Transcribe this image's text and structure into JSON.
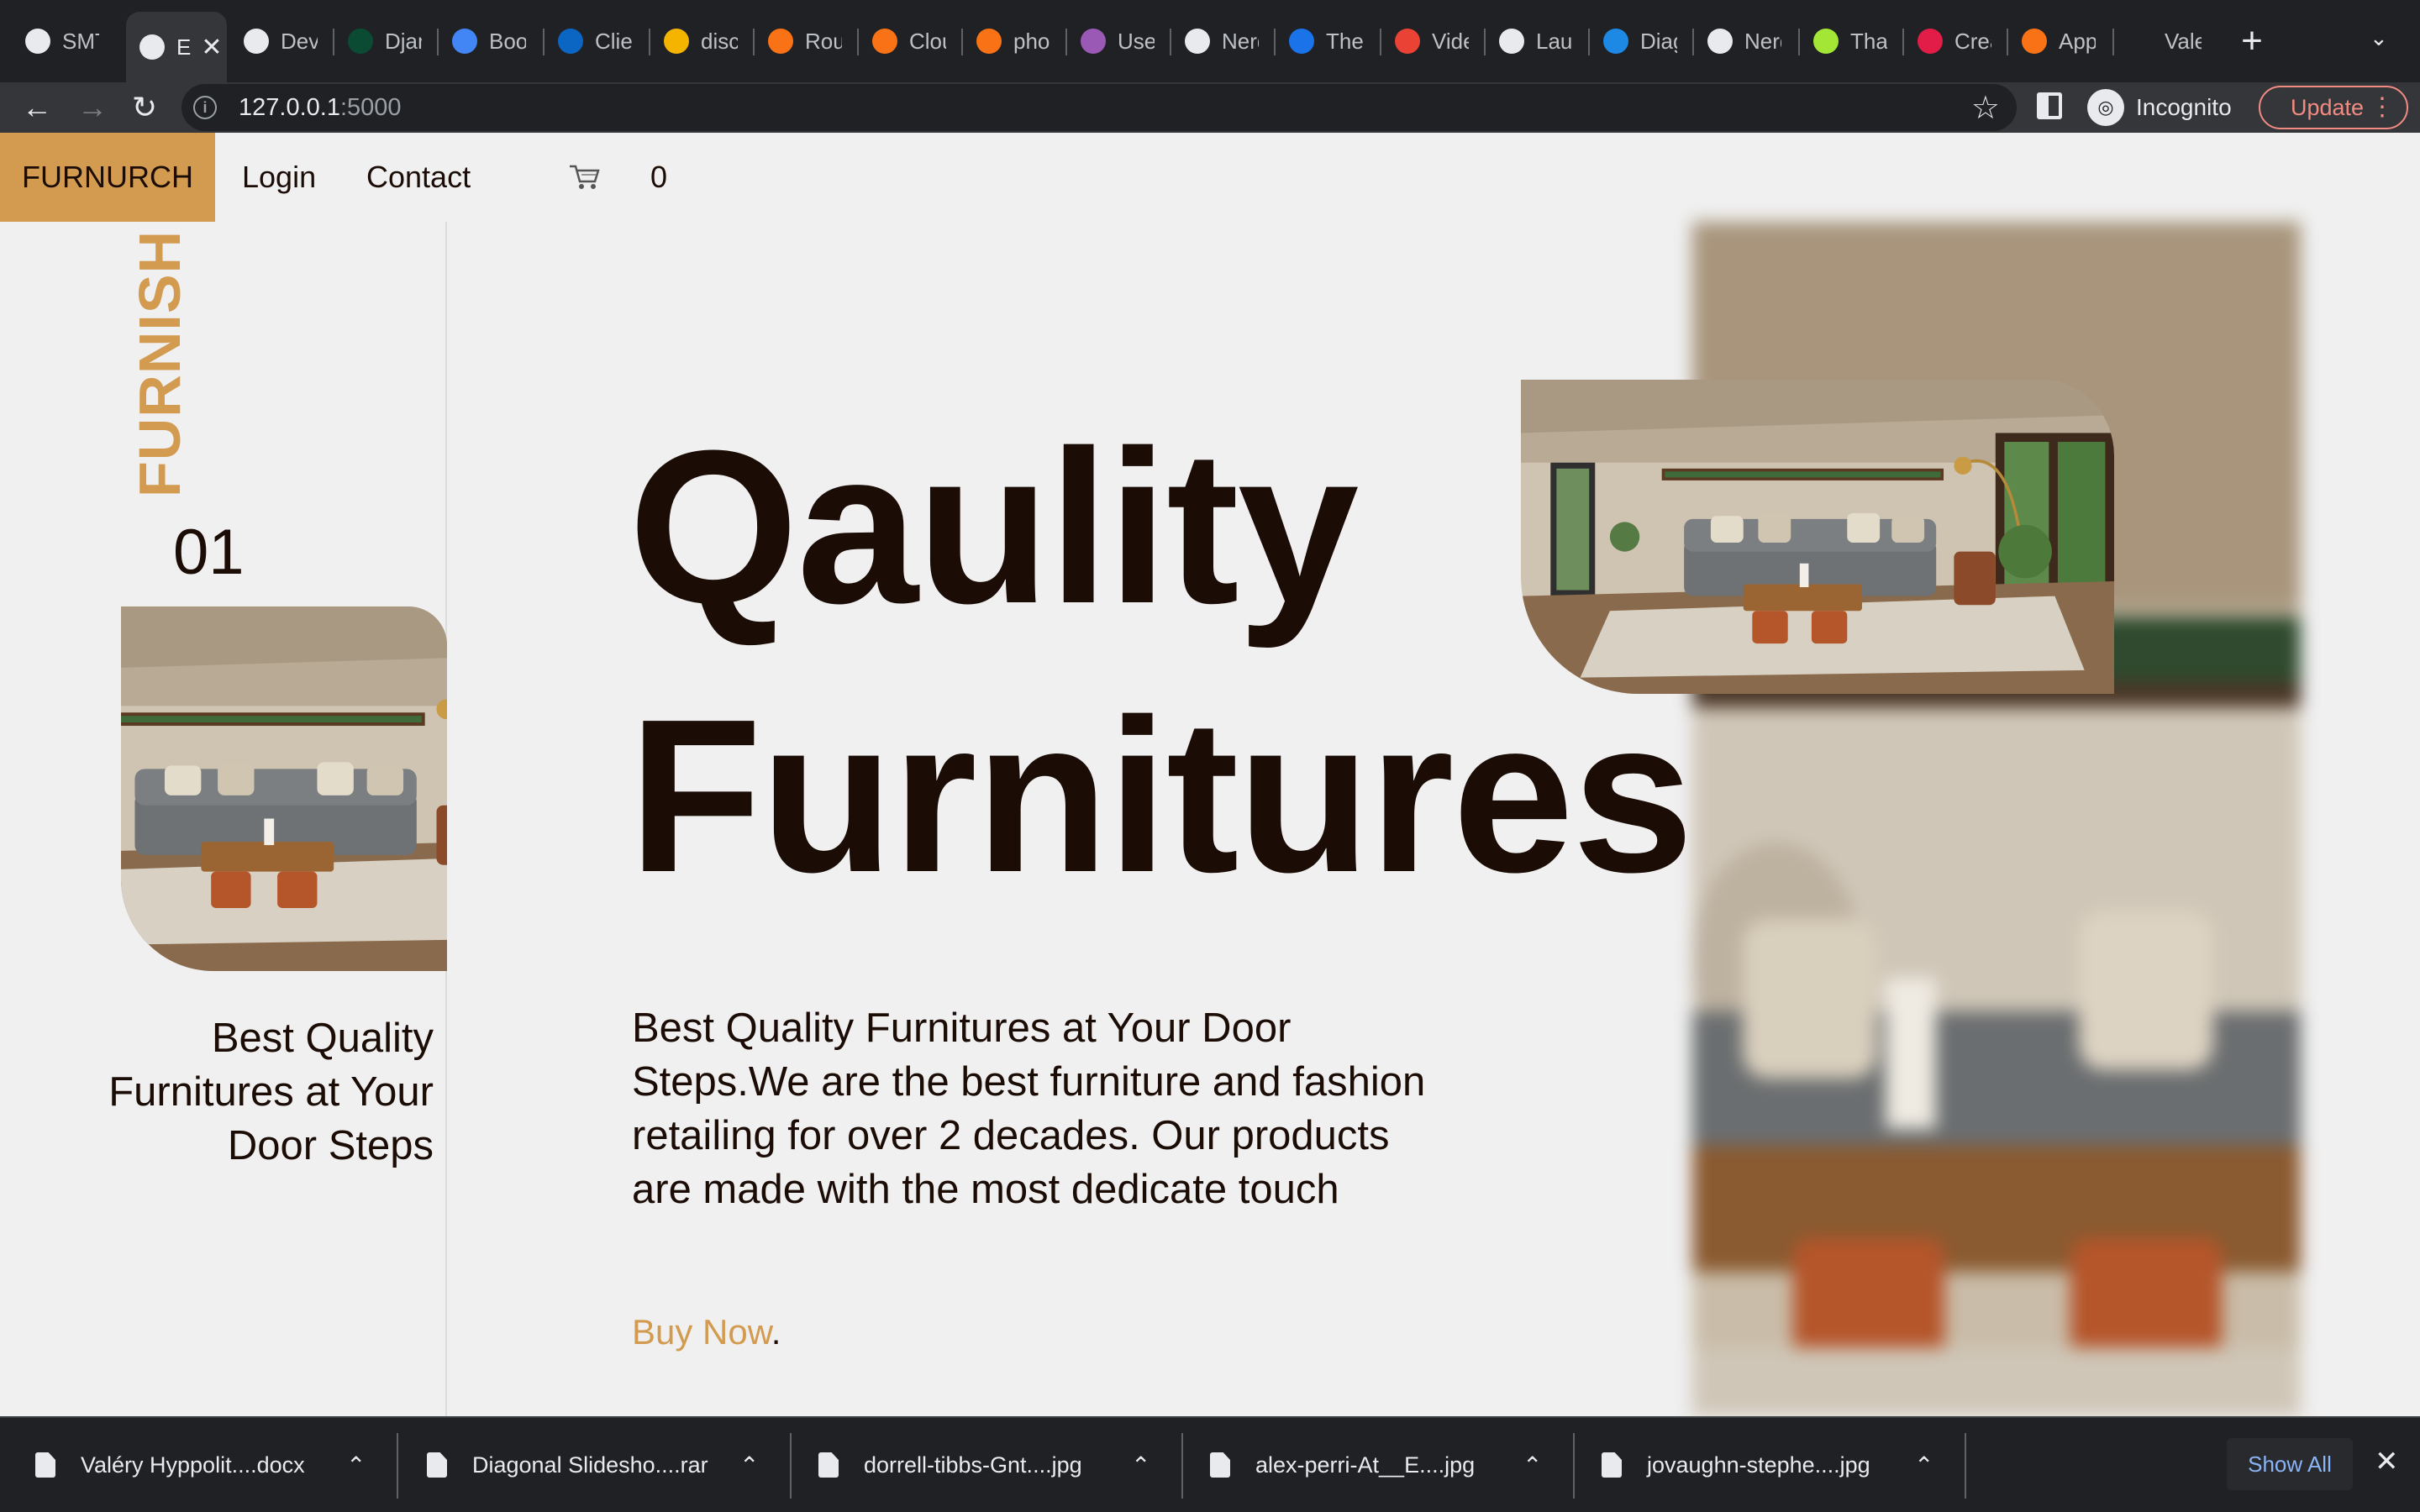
{
  "browser": {
    "tabs": [
      {
        "label": "SMT",
        "icon": "globe-icon",
        "color": "#e8eaed"
      },
      {
        "label": "E",
        "icon": "globe-icon",
        "color": "#e8eaed",
        "active": true
      },
      {
        "label": "Dev",
        "icon": "globe-icon",
        "color": "#e8eaed"
      },
      {
        "label": "Djan",
        "icon": "django-icon",
        "color": "#0c4b33"
      },
      {
        "label": "Boo",
        "icon": "bootstrap-icon",
        "color": "#4285f4"
      },
      {
        "label": "Clie",
        "icon": "linkedin-icon",
        "color": "#0a66c2"
      },
      {
        "label": "disc",
        "icon": "box-icon",
        "color": "#f4b400"
      },
      {
        "label": "Rou",
        "icon": "cube-icon",
        "color": "#f97316"
      },
      {
        "label": "Clou",
        "icon": "cube-icon",
        "color": "#f97316"
      },
      {
        "label": "pho",
        "icon": "cube-icon",
        "color": "#f97316"
      },
      {
        "label": "Use",
        "icon": "hexagon-icon",
        "color": "#9b59b6"
      },
      {
        "label": "Nerd",
        "icon": "globe-icon",
        "color": "#e8eaed"
      },
      {
        "label": "The",
        "icon": "wave-icon",
        "color": "#1a73e8"
      },
      {
        "label": "Vide",
        "icon": "gmail-icon",
        "color": "#ea4335"
      },
      {
        "label": "Lau",
        "icon": "globe-icon",
        "color": "#e8eaed"
      },
      {
        "label": "Diag",
        "icon": "drawio-icon",
        "color": "#1e88e5"
      },
      {
        "label": "Nerd",
        "icon": "globe-icon",
        "color": "#e8eaed"
      },
      {
        "label": "Tha",
        "icon": "pill-icon",
        "color": "#a3e635"
      },
      {
        "label": "Crea",
        "icon": "d-icon",
        "color": "#e11d48"
      },
      {
        "label": "App",
        "icon": "firefox-icon",
        "color": "#f97316"
      },
      {
        "label": "Vale",
        "icon": "github-icon",
        "color": "#202124"
      }
    ],
    "active_tab_close": "✕",
    "new_tab": "+",
    "tab_search": "⌄",
    "url_host": "127.0.0.1",
    "url_port": ":5000",
    "incognito_label": "Incognito",
    "update_label": "Update"
  },
  "site": {
    "brand": "FURNURCH",
    "nav": {
      "login": "Login",
      "contact": "Contact"
    },
    "cart_count": "0",
    "side_word": "FURNISH",
    "slide_number": "01",
    "side_tagline": "Best Quality Furnitures at Your Door Steps",
    "headline_line1": "Qaulity",
    "headline_line2": "Furnitures",
    "description": "Best Quality Furnitures at Your Door Steps.We are the best furniture and fashion retailing for over 2 decades. Our products are made with the most dedicate touch",
    "cta": "Buy Now",
    "cta_suffix": ".",
    "colors": {
      "accent": "#d29b50",
      "text": "#1b0c06",
      "background": "#f0f0f0"
    }
  },
  "downloads": {
    "items": [
      {
        "name": "Valéry Hyppolit....docx"
      },
      {
        "name": "Diagonal Slidesho....rar"
      },
      {
        "name": "dorrell-tibbs-Gnt....jpg"
      },
      {
        "name": "alex-perri-At__E....jpg"
      },
      {
        "name": "jovaughn-stephe....jpg"
      }
    ],
    "show_all": "Show All",
    "close": "✕"
  }
}
